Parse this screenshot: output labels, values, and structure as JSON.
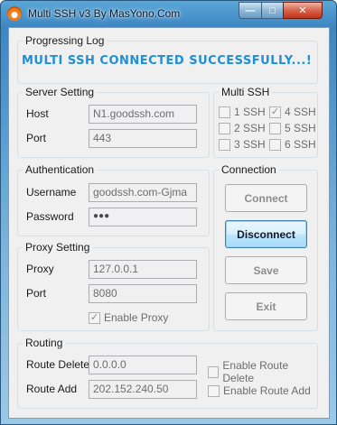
{
  "window": {
    "title": "Multi SSH v3 By MasYono.Com"
  },
  "progress_log": {
    "title": "Progressing Log",
    "status": "MULTI SSH CONNECTED SUCCESSFULLY...!"
  },
  "server_setting": {
    "title": "Server Setting",
    "host_label": "Host",
    "host_value": "N1.goodssh.com",
    "port_label": "Port",
    "port_value": "443"
  },
  "multi_ssh": {
    "title": "Multi SSH",
    "options": [
      {
        "label": "1 SSH",
        "checked": false
      },
      {
        "label": "4 SSH",
        "checked": true
      },
      {
        "label": "2 SSH",
        "checked": false
      },
      {
        "label": "5 SSH",
        "checked": false
      },
      {
        "label": "3 SSH",
        "checked": false
      },
      {
        "label": "6 SSH",
        "checked": false
      }
    ]
  },
  "authentication": {
    "title": "Authentication",
    "username_label": "Username",
    "username_value": "goodssh.com-Gjma",
    "password_label": "Password",
    "password_value": "●●●"
  },
  "connection": {
    "title": "Connection",
    "connect_label": "Connect",
    "disconnect_label": "Disconnect",
    "save_label": "Save",
    "exit_label": "Exit"
  },
  "proxy_setting": {
    "title": "Proxy Setting",
    "proxy_label": "Proxy",
    "proxy_value": "127.0.0.1",
    "port_label": "Port",
    "port_value": "8080",
    "enable_label": "Enable Proxy",
    "enable_checked": true
  },
  "routing": {
    "title": "Routing",
    "delete_label": "Route Delete",
    "delete_value": "0.0.0.0",
    "add_label": "Route Add",
    "add_value": "202.152.240.50",
    "enable_delete_label": "Enable Route Delete",
    "enable_add_label": "Enable Route Add"
  },
  "colors": {
    "status_text": "#1e90d8",
    "active_button_border": "#3c7fb1"
  }
}
